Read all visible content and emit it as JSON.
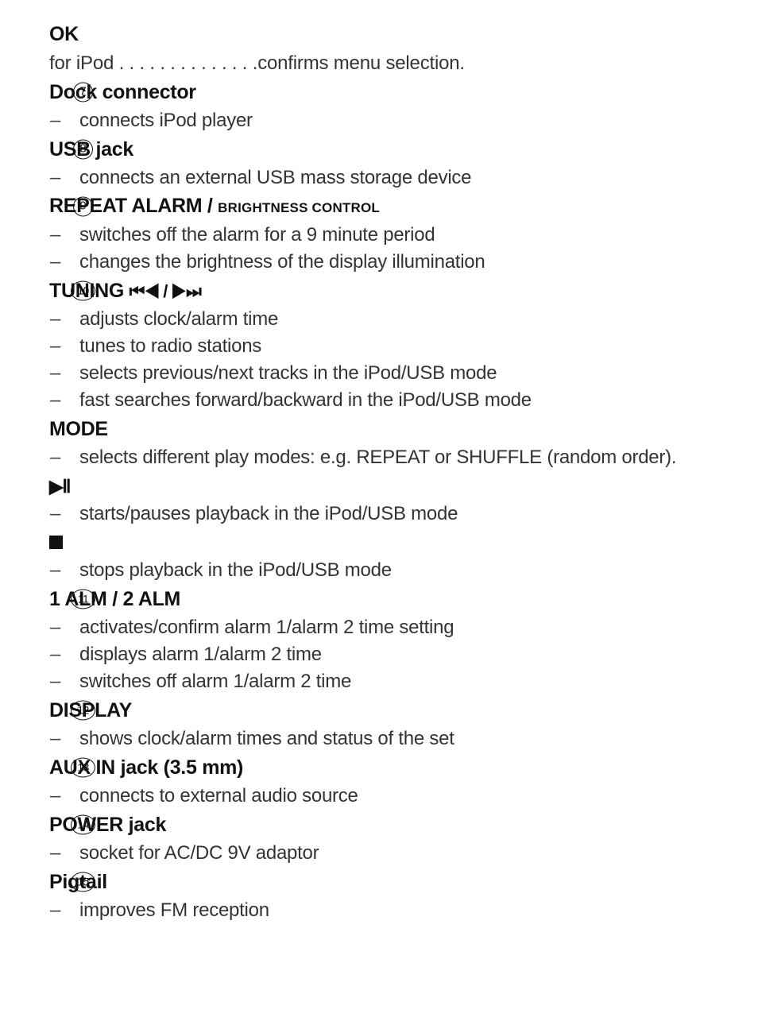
{
  "document": {
    "entries": [
      {
        "id": "ok",
        "marker": null,
        "heading": "OK",
        "lines": [
          {
            "type": "plain",
            "text": "for iPod . . . . . . . . . . . . . .confirms menu selection."
          }
        ]
      },
      {
        "id": "dock-connector",
        "marker": "7",
        "heading": "Dock connector",
        "lines": [
          {
            "type": "bullet",
            "dash": "–",
            "text": "connects iPod player"
          }
        ]
      },
      {
        "id": "usb-jack",
        "marker": "8",
        "heading": "USB jack",
        "lines": [
          {
            "type": "bullet",
            "dash": "–",
            "text": "connects an external USB mass storage device"
          }
        ]
      },
      {
        "id": "repeat-alarm",
        "marker": "9",
        "heading": "REPEAT ALARM / ",
        "heading_small_caps": "BRIGHTNESS CONTROL",
        "lines": [
          {
            "type": "bullet",
            "dash": "–",
            "text": "switches off the alarm for a 9 minute period"
          },
          {
            "type": "bullet",
            "dash": "–",
            "text": "changes the brightness of the display illumination"
          }
        ]
      },
      {
        "id": "tuning",
        "marker": "10",
        "heading": "TUNING ",
        "heading_glyph": "⏮◀ / ▶⏭",
        "lines": [
          {
            "type": "bullet",
            "dash": "–",
            "text": "adjusts clock/alarm time"
          },
          {
            "type": "bullet",
            "dash": "–",
            "text": "tunes to radio stations"
          },
          {
            "type": "bullet",
            "dash": "–",
            "text": "selects previous/next tracks in the iPod/USB mode"
          },
          {
            "type": "bullet",
            "dash": "–",
            "text": "fast searches forward/backward in the iPod/USB mode"
          }
        ]
      },
      {
        "id": "mode",
        "marker": null,
        "heading": "MODE",
        "lines": [
          {
            "type": "bullet",
            "dash": "–",
            "text": "selects different play modes: e.g. REPEAT or SHUFFLE (random order)."
          }
        ]
      },
      {
        "id": "play-pause",
        "marker": null,
        "heading_symbol": "▶Ⅱ",
        "symbol_name": "play-pause-icon",
        "lines": [
          {
            "type": "bullet",
            "dash": "–",
            "text": "starts/pauses playback in the iPod/USB mode"
          }
        ]
      },
      {
        "id": "stop",
        "marker": null,
        "heading_symbol": "■",
        "symbol_name": "stop-icon",
        "lines": [
          {
            "type": "bullet",
            "dash": "–",
            "text": "stops playback in the iPod/USB mode"
          }
        ]
      },
      {
        "id": "alarm-1-2",
        "marker": "11",
        "heading": "1 ALM / 2 ALM",
        "lines": [
          {
            "type": "bullet",
            "dash": "–",
            "text": "activates/confirm alarm 1/alarm 2 time setting"
          },
          {
            "type": "bullet",
            "dash": "–",
            "text": "displays alarm 1/alarm 2 time"
          },
          {
            "type": "bullet",
            "dash": "–",
            "text": "switches off alarm 1/alarm 2 time"
          }
        ]
      },
      {
        "id": "display",
        "marker": "12",
        "heading": "DISPLAY",
        "lines": [
          {
            "type": "bullet",
            "dash": "–",
            "text": "shows clock/alarm times and status of the set"
          }
        ]
      },
      {
        "id": "aux-in-jack",
        "marker": "13",
        "heading": "AUX IN jack (3.5 mm)",
        "lines": [
          {
            "type": "bullet",
            "dash": "–",
            "text": "connects to external audio source"
          }
        ]
      },
      {
        "id": "power-jack",
        "marker": "14",
        "heading": "POWER jack",
        "lines": [
          {
            "type": "bullet",
            "dash": "–",
            "text": "socket for AC/DC 9V adaptor"
          }
        ]
      },
      {
        "id": "pigtail",
        "marker": "15",
        "heading": "Pigtail",
        "lines": [
          {
            "type": "bullet",
            "dash": "–",
            "text": "improves FM reception"
          }
        ]
      }
    ]
  }
}
